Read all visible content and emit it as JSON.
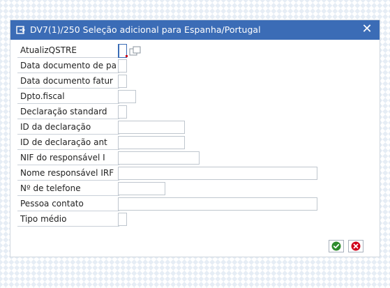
{
  "dialog": {
    "title": "DV7(1)/250 Seleção adicional para Espanha/Portugal",
    "close_glyph": "✕"
  },
  "fields": [
    {
      "label": "AtualizQSTRE",
      "type": "checkbox",
      "value": ""
    },
    {
      "label": "Data documento de pa",
      "type": "checkbox",
      "value": ""
    },
    {
      "label": "Data documento fatur",
      "type": "checkbox",
      "value": ""
    },
    {
      "label": "Dpto.fiscal",
      "type": "text",
      "value": ""
    },
    {
      "label": "Declaração standard",
      "type": "checkbox",
      "value": ""
    },
    {
      "label": "ID da declaração",
      "type": "text",
      "value": ""
    },
    {
      "label": "ID de declaração ant",
      "type": "text",
      "value": ""
    },
    {
      "label": "NIF do responsável I",
      "type": "text",
      "value": ""
    },
    {
      "label": "Nome responsável IRF",
      "type": "text",
      "value": ""
    },
    {
      "label": "Nº de telefone",
      "type": "text",
      "value": ""
    },
    {
      "label": "Pessoa contato",
      "type": "text",
      "value": ""
    },
    {
      "label": "Tipo médio",
      "type": "checkbox",
      "value": ""
    }
  ],
  "buttons": {
    "confirm_icon": "check-icon",
    "cancel_icon": "cancel-icon",
    "confirm_color": "#2e8b2e",
    "cancel_color": "#d0021b"
  },
  "colors": {
    "titlebar": "#3b6cb6"
  }
}
